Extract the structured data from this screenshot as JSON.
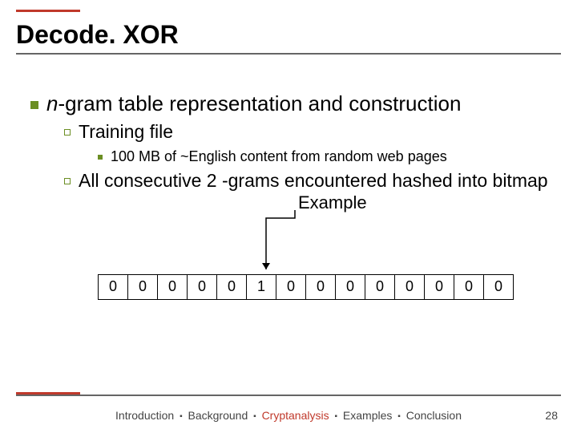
{
  "title": "Decode. XOR",
  "bullets": {
    "lvl1_prefix": "n",
    "lvl1_rest": "-gram table representation and construction",
    "lvl2a": "Training file",
    "lvl3a": "100 MB of ~English content from random web pages",
    "lvl2b": "All consecutive 2 -grams encountered hashed into bitmap"
  },
  "example_label": "Example",
  "bitmap": [
    "0",
    "0",
    "0",
    "0",
    "0",
    "1",
    "0",
    "0",
    "0",
    "0",
    "0",
    "0",
    "0",
    "0"
  ],
  "footer": {
    "intro": "Introduction",
    "bg": "Background",
    "crypt": "Cryptanalysis",
    "ex": "Examples",
    "concl": "Conclusion"
  },
  "page": "28"
}
